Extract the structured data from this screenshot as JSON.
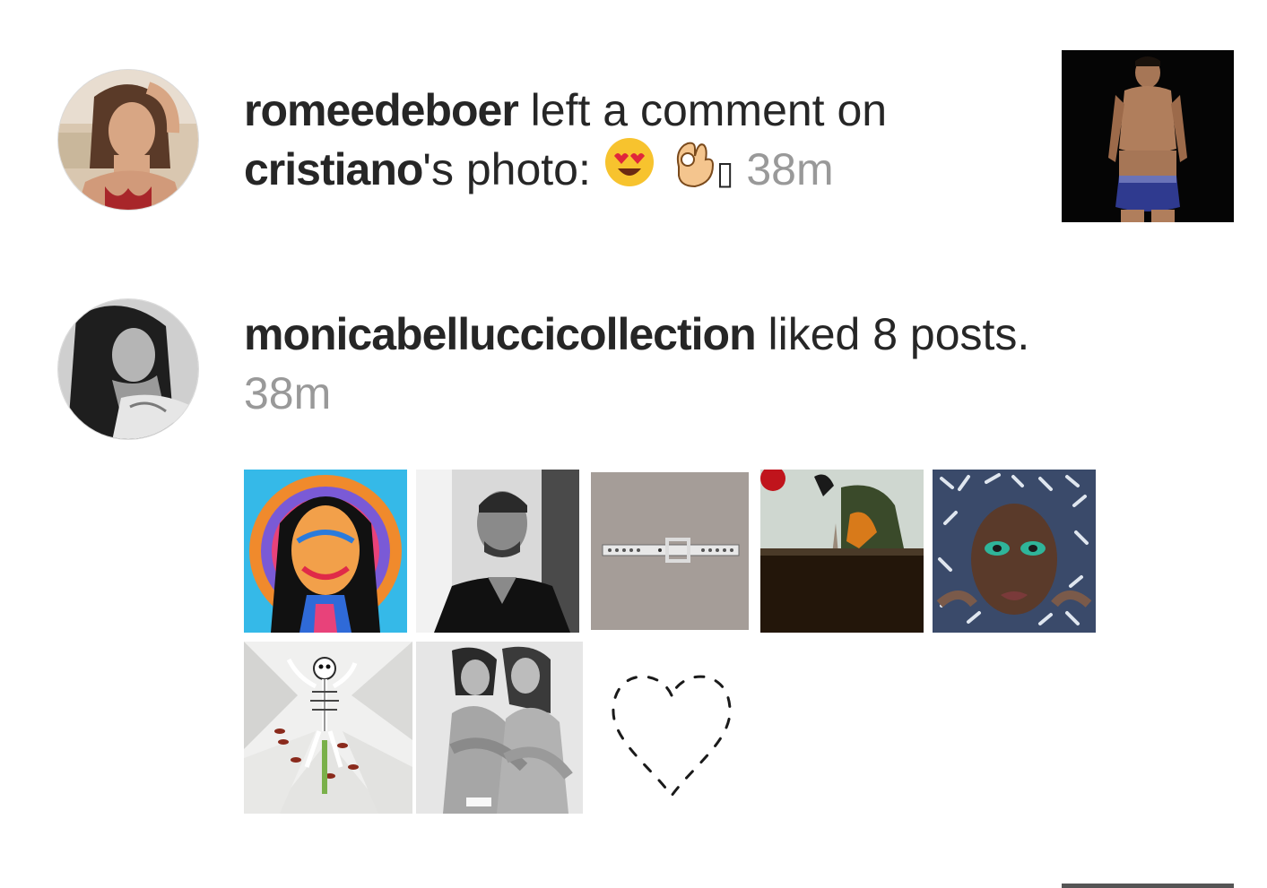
{
  "notifications": [
    {
      "username": "romeedeboer",
      "action_text": " left a comment on",
      "target_user": "cristiano",
      "target_suffix": "'s photo: ",
      "emoji_missing_glyph": "▯",
      "time": " 38m",
      "avatar_icon": "profile-photo-woman-red-bikini",
      "post_icon": "photo-man-underwear-dark-background"
    },
    {
      "username": "monicabelluccicollection",
      "action_text": " liked 8 posts.",
      "time": "38m",
      "avatar_icon": "profile-photo-woman-black-white",
      "liked_posts": [
        {
          "icon": "psychedelic-portrait"
        },
        {
          "icon": "man-black-white-portrait"
        },
        {
          "icon": "silver-studded-belt"
        },
        {
          "icon": "window-red-flower"
        },
        {
          "icon": "face-glitter-eyes"
        },
        {
          "icon": "skeleton-in-lily"
        },
        {
          "icon": "two-women-black-white"
        },
        {
          "icon": "dashed-heart"
        }
      ]
    }
  ]
}
